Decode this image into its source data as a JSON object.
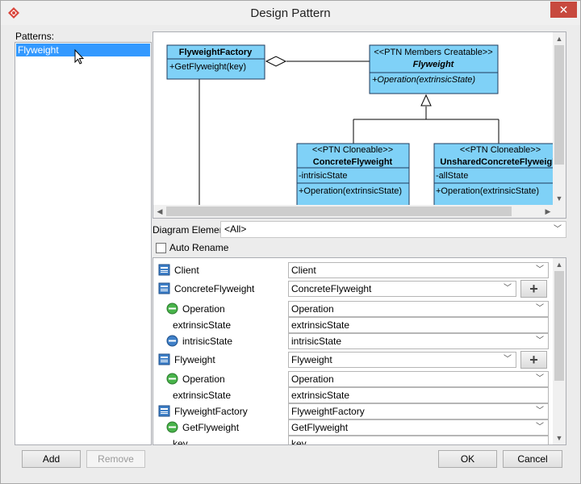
{
  "window": {
    "title": "Design Pattern",
    "close_glyph": "✕"
  },
  "patterns": {
    "label": "Patterns:",
    "items": [
      "Flyweight"
    ]
  },
  "diagram": {
    "classes": {
      "factory": {
        "name": "FlyweightFactory",
        "op": "+GetFlyweight(key)"
      },
      "flyweight": {
        "stereotype": "<<PTN Members Creatable>>",
        "name": "Flyweight",
        "op": "+Operation(extrinsicState)"
      },
      "concrete": {
        "stereotype": "<<PTN Cloneable>>",
        "name": "ConcreteFlyweight",
        "attr": "-intrisicState",
        "op": "+Operation(extrinsicState)"
      },
      "unshared": {
        "stereotype": "<<PTN Cloneable>>",
        "name": "UnsharedConcreteFlyweight",
        "attr": "-allState",
        "op": "+Operation(extrinsicState)"
      }
    }
  },
  "diagram_element": {
    "label": "Diagram Element",
    "value": "<All>"
  },
  "auto_rename": {
    "label": "Auto Rename",
    "checked": false
  },
  "properties": [
    {
      "label": "Client",
      "value": "Client",
      "kind": "class",
      "indent": 0,
      "plus": false,
      "dropdown": true
    },
    {
      "label": "ConcreteFlyweight",
      "value": "ConcreteFlyweight",
      "kind": "class",
      "indent": 0,
      "plus": true,
      "dropdown": true
    },
    {
      "label": "Operation",
      "value": "Operation",
      "kind": "operation",
      "indent": 1,
      "plus": false,
      "dropdown": true
    },
    {
      "label": "extrinsicState",
      "value": "extrinsicState",
      "kind": "none",
      "indent": 1,
      "plus": false,
      "dropdown": false
    },
    {
      "label": "intrisicState",
      "value": "intrisicState",
      "kind": "attribute",
      "indent": 1,
      "plus": false,
      "dropdown": true
    },
    {
      "label": "Flyweight",
      "value": "Flyweight",
      "kind": "class",
      "indent": 0,
      "plus": true,
      "dropdown": true
    },
    {
      "label": "Operation",
      "value": "Operation",
      "kind": "operation",
      "indent": 1,
      "plus": false,
      "dropdown": true
    },
    {
      "label": "extrinsicState",
      "value": "extrinsicState",
      "kind": "none",
      "indent": 1,
      "plus": false,
      "dropdown": false
    },
    {
      "label": "FlyweightFactory",
      "value": "FlyweightFactory",
      "kind": "class",
      "indent": 0,
      "plus": false,
      "dropdown": true
    },
    {
      "label": "GetFlyweight",
      "value": "GetFlyweight",
      "kind": "operation",
      "indent": 1,
      "plus": false,
      "dropdown": true
    },
    {
      "label": "key",
      "value": "key",
      "kind": "none",
      "indent": 1,
      "plus": false,
      "dropdown": false
    }
  ],
  "buttons": {
    "add": "Add",
    "remove": "Remove",
    "ok": "OK",
    "cancel": "Cancel"
  },
  "colors": {
    "class_fill": "#7fd1f7",
    "class_border": "#1f3b5c",
    "selection": "#3399ff",
    "close": "#c7493e"
  }
}
